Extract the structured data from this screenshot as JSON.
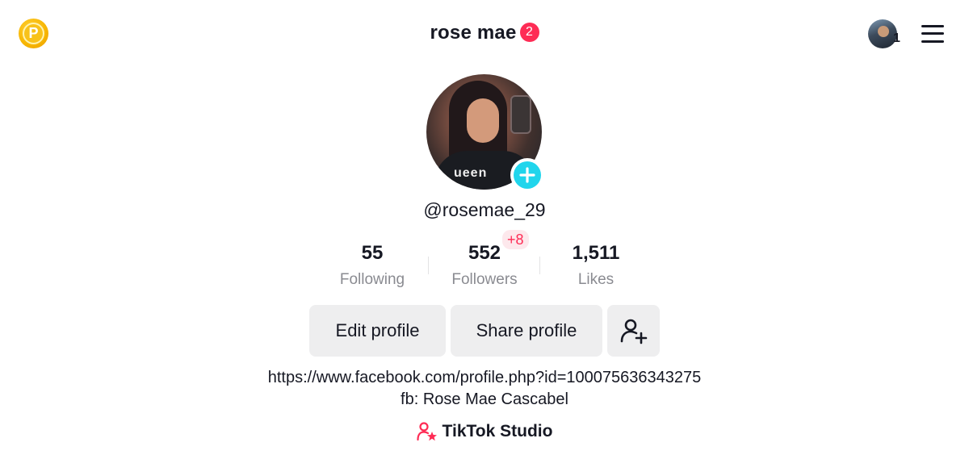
{
  "header": {
    "title": "rose mae",
    "notification_count": "2",
    "coin_letter": "P",
    "account_count": "1"
  },
  "profile": {
    "username": "@rosemae_29",
    "avatar_print": "ueen"
  },
  "stats": {
    "following": {
      "value": "55",
      "label": "Following"
    },
    "followers": {
      "value": "552",
      "label": "Followers",
      "delta": "+8"
    },
    "likes": {
      "value": "1,511",
      "label": "Likes"
    }
  },
  "actions": {
    "edit_profile": "Edit profile",
    "share_profile": "Share profile",
    "add_friend_icon": "person-add-icon"
  },
  "bio": {
    "url": "https://www.facebook.com/profile.php?id=100075636343275",
    "fb_line": "fb: Rose Mae Cascabel"
  },
  "studio": {
    "label": "TikTok Studio",
    "icon": "studio-person-star-icon"
  },
  "colors": {
    "accent_red": "#fe2c55",
    "accent_cyan": "#20d5ec",
    "coin_gold": "#f7b500",
    "button_bg": "#eeeeef",
    "secondary_text": "#8a8b91"
  }
}
